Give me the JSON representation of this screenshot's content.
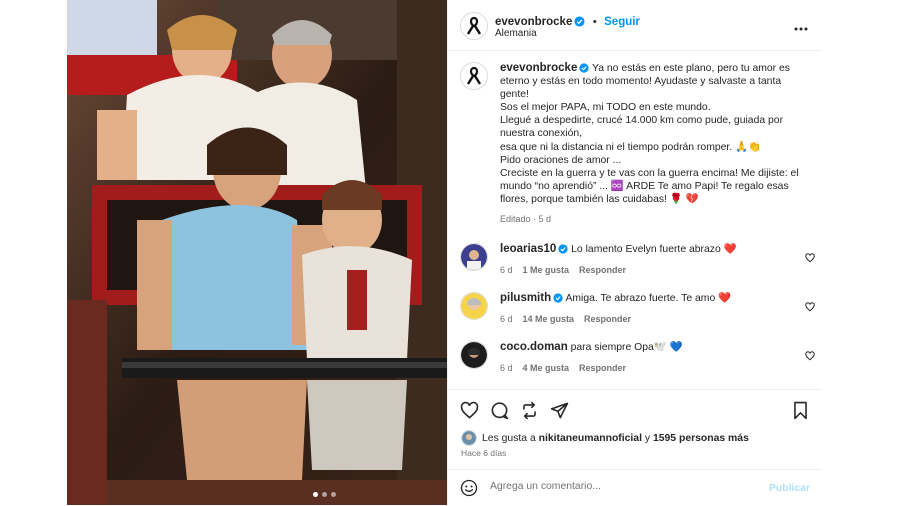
{
  "post": {
    "username": "evevonbrocke",
    "location": "Alemania",
    "follow_label": "Seguir",
    "separator": "•"
  },
  "caption": {
    "username": "evevonbrocke",
    "lines": [
      "Ya no estás en este plano, pero tu amor es eterno y estás en todo momento! Ayudaste y salvaste a tanta gente!",
      "Sos el mejor PAPA, mi TODO en este mundo.",
      "Llegué a despedirte, crucé 14.000 km como pude, guiada por nuestra conexión,",
      "esa que ni la distancia ni el tiempo podrán romper. 🙏👏",
      "Pido oraciones de amor ...",
      "Creciste en la guerra y te vas con la guerra encima! Me dijiste: el mundo “no aprendió” ... ♾️ ARDE Te amo Papi! Te regalo esas flores, porque también las cuidabas! 🌹 💔"
    ],
    "edited": "Editado",
    "edited_time": "5 d"
  },
  "comments": [
    {
      "username": "leoarias10",
      "verified": true,
      "text": "Lo lamento Evelyn fuerte abrazo ❤️",
      "time": "6 d",
      "likes": "1 Me gusta",
      "reply": "Responder"
    },
    {
      "username": "pilusmith",
      "verified": true,
      "text": "Amiga. Te abrazo fuerte. Te amo ❤️",
      "time": "6 d",
      "likes": "14 Me gusta",
      "reply": "Responder"
    },
    {
      "username": "coco.doman",
      "verified": false,
      "text": "para siempre Opa🕊️ 💙",
      "time": "6 d",
      "likes": "4 Me gusta",
      "reply": "Responder"
    }
  ],
  "likes": {
    "prefix": "Les gusta a",
    "user": "nikitaneumannoficial",
    "middle": "y",
    "count": "1595 personas más"
  },
  "time_ago": "Hace 6 días",
  "comment_box": {
    "placeholder": "Agrega un comentario...",
    "publish": "Publicar"
  },
  "colors": {
    "accent": "#0095f6",
    "heart": "#ed4956",
    "muted": "#737373",
    "publish_disabled": "#b2dffc"
  },
  "carousel": {
    "slides": 3,
    "active": 1
  }
}
